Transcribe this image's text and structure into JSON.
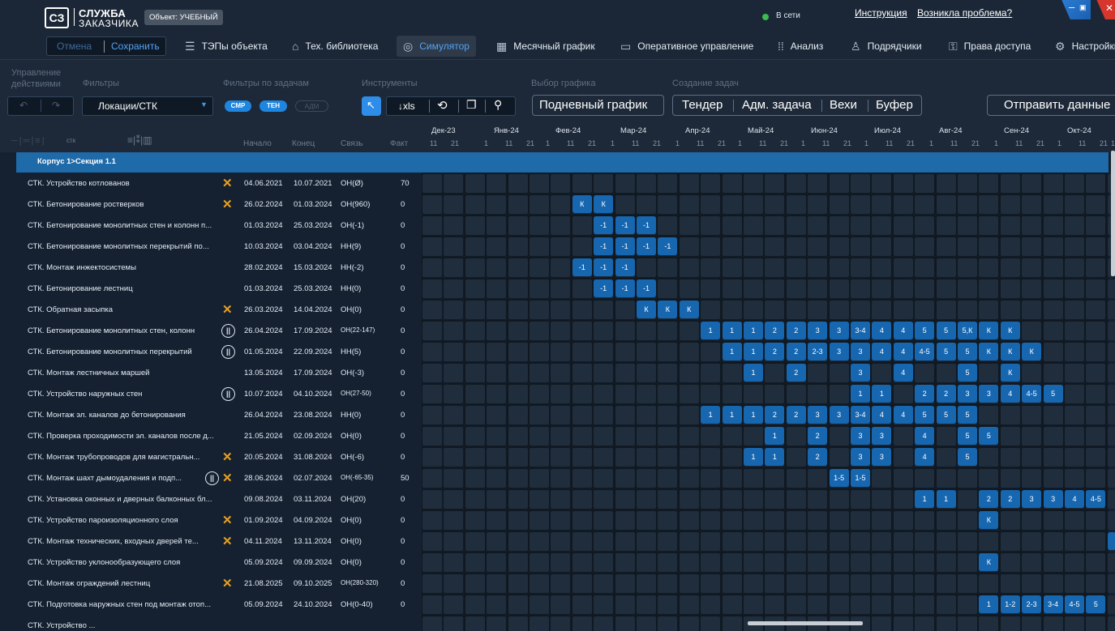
{
  "app": {
    "logo": "СЗ",
    "brand_line1": "СЛУЖБА",
    "brand_line2": "ЗАКАЗЧИКА",
    "object_badge": "Объект: УЧЕБНЫЙ",
    "status": "В сети",
    "link_instructions": "Инструкция",
    "link_problem": "Возникла проблема?"
  },
  "nav": {
    "cancel": "Отмена",
    "save": "Сохранить",
    "items": [
      "ТЭПы объекта",
      "Тех. библиотека",
      "Симулятор",
      "Месячный график",
      "Оперативное управление",
      "Анализ",
      "Подрядчики",
      "Права доступа",
      "Настройки"
    ]
  },
  "toolbar": {
    "label_actions": "Управление действиями",
    "label_filters": "Фильтры",
    "filter_value": "Локации/СТК",
    "label_task_filters": "Фильтры по задачам",
    "pills": [
      "СМР",
      "ТЕН",
      "АДМ"
    ],
    "label_tools": "Инструменты",
    "export_label": "↓xls",
    "label_schedule": "Выбор графика",
    "schedule_btn": "Подневный график",
    "label_create": "Создание задач",
    "create_items": [
      "Тендер",
      "Адм. задача",
      "Вехи",
      "Буфер"
    ],
    "send_btn": "Отправить данные"
  },
  "header": {
    "stk": "стк",
    "col_start": "Начало",
    "col_end": "Конец",
    "col_link": "Связь",
    "col_fact": "Факт",
    "months": [
      "Дек-23",
      "Янв-24",
      "Фев-24",
      "Мар-24",
      "Апр-24",
      "Май-24",
      "Июн-24",
      "Июл-24",
      "Авг-24",
      "Сен-24",
      "Окт-24"
    ],
    "month_days": [
      [
        "11",
        "21"
      ],
      [
        "1",
        "11",
        "21"
      ],
      [
        "1",
        "11",
        "21"
      ],
      [
        "1",
        "11",
        "21"
      ],
      [
        "1",
        "11",
        "21"
      ],
      [
        "1",
        "11",
        "21"
      ],
      [
        "1",
        "11",
        "21"
      ],
      [
        "1",
        "11",
        "21"
      ],
      [
        "1",
        "11",
        "21"
      ],
      [
        "1",
        "11",
        "21"
      ],
      [
        "1",
        "11",
        "21"
      ]
    ],
    "trailing_day": "1"
  },
  "group": "Корпус 1>Секция 1.1",
  "tasks": [
    {
      "name": "СТК. Устройство котлованов",
      "start": "04.06.2021",
      "end": "10.07.2021",
      "link": "ОН(Ø)",
      "fact": "70",
      "icons": [
        "x"
      ],
      "cells": []
    },
    {
      "name": "СТК. Бетонирование ростверков",
      "start": "26.02.2024",
      "end": "01.03.2024",
      "link": "ОН(960)",
      "fact": "0",
      "icons": [
        "x"
      ],
      "cells": [
        [
          7,
          "К"
        ],
        [
          8,
          "К"
        ]
      ]
    },
    {
      "name": "СТК. Бетонирование монолитных стен и колонн п...",
      "start": "01.03.2024",
      "end": "25.03.2024",
      "link": "ОН(-1)",
      "fact": "0",
      "icons": [],
      "cells": [
        [
          8,
          "-1"
        ],
        [
          9,
          "-1"
        ],
        [
          10,
          "-1"
        ]
      ]
    },
    {
      "name": "СТК. Бетонирование монолитных перекрытий по...",
      "start": "10.03.2024",
      "end": "03.04.2024",
      "link": "НН(9)",
      "fact": "0",
      "icons": [],
      "cells": [
        [
          8,
          "-1"
        ],
        [
          9,
          "-1"
        ],
        [
          10,
          "-1"
        ],
        [
          11,
          "-1"
        ]
      ]
    },
    {
      "name": "СТК. Монтаж инжектосистемы",
      "start": "28.02.2024",
      "end": "15.03.2024",
      "link": "НН(-2)",
      "fact": "0",
      "icons": [],
      "cells": [
        [
          7,
          "-1"
        ],
        [
          8,
          "-1"
        ],
        [
          9,
          "-1"
        ]
      ]
    },
    {
      "name": "СТК. Бетонирование лестниц",
      "start": "01.03.2024",
      "end": "25.03.2024",
      "link": "НН(0)",
      "fact": "0",
      "icons": [],
      "cells": [
        [
          8,
          "-1"
        ],
        [
          9,
          "-1"
        ],
        [
          10,
          "-1"
        ]
      ]
    },
    {
      "name": "СТК. Обратная засыпка",
      "start": "26.03.2024",
      "end": "14.04.2024",
      "link": "ОН(0)",
      "fact": "0",
      "icons": [
        "x"
      ],
      "cells": [
        [
          10,
          "К"
        ],
        [
          11,
          "К"
        ],
        [
          12,
          "К"
        ]
      ]
    },
    {
      "name": "СТК. Бетонирование монолитных стен, колонн",
      "start": "26.04.2024",
      "end": "17.09.2024",
      "link": "ОН(22-147)",
      "fact": "0",
      "icons": [
        "p"
      ],
      "cells": [
        [
          13,
          "1"
        ],
        [
          14,
          "1"
        ],
        [
          15,
          "1"
        ],
        [
          16,
          "2"
        ],
        [
          17,
          "2"
        ],
        [
          18,
          "3"
        ],
        [
          19,
          "3"
        ],
        [
          20,
          "3-4"
        ],
        [
          21,
          "4"
        ],
        [
          22,
          "4"
        ],
        [
          23,
          "5"
        ],
        [
          24,
          "5"
        ],
        [
          25,
          "5,К"
        ],
        [
          26,
          "К"
        ],
        [
          27,
          "К"
        ]
      ]
    },
    {
      "name": "СТК. Бетонирование монолитных перекрытий",
      "start": "01.05.2024",
      "end": "22.09.2024",
      "link": "НН(5)",
      "fact": "0",
      "icons": [
        "p"
      ],
      "cells": [
        [
          14,
          "1"
        ],
        [
          15,
          "1"
        ],
        [
          16,
          "2"
        ],
        [
          17,
          "2"
        ],
        [
          18,
          "2-3"
        ],
        [
          19,
          "3"
        ],
        [
          20,
          "3"
        ],
        [
          21,
          "4"
        ],
        [
          22,
          "4"
        ],
        [
          23,
          "4-5"
        ],
        [
          24,
          "5"
        ],
        [
          25,
          "5"
        ],
        [
          26,
          "К"
        ],
        [
          27,
          "К"
        ],
        [
          28,
          "К"
        ]
      ]
    },
    {
      "name": "СТК. Монтаж лестничных маршей",
      "start": "13.05.2024",
      "end": "17.09.2024",
      "link": "ОН(-3)",
      "fact": "0",
      "icons": [],
      "cells": [
        [
          15,
          "1"
        ],
        [
          17,
          "2"
        ],
        [
          20,
          "3"
        ],
        [
          22,
          "4"
        ],
        [
          25,
          "5"
        ],
        [
          27,
          "К"
        ]
      ]
    },
    {
      "name": "СТК. Устройство наружных стен",
      "start": "10.07.2024",
      "end": "04.10.2024",
      "link": "ОН(27-50)",
      "fact": "0",
      "icons": [
        "p"
      ],
      "cells": [
        [
          20,
          "1"
        ],
        [
          21,
          "1"
        ],
        [
          23,
          "2"
        ],
        [
          24,
          "2"
        ],
        [
          25,
          "3"
        ],
        [
          26,
          "3"
        ],
        [
          27,
          "4"
        ],
        [
          28,
          "4-5"
        ],
        [
          29,
          "5"
        ]
      ]
    },
    {
      "name": "СТК. Монтаж эл. каналов до бетонирования",
      "start": "26.04.2024",
      "end": "23.08.2024",
      "link": "НН(0)",
      "fact": "0",
      "icons": [],
      "cells": [
        [
          13,
          "1"
        ],
        [
          14,
          "1"
        ],
        [
          15,
          "1"
        ],
        [
          16,
          "2"
        ],
        [
          17,
          "2"
        ],
        [
          18,
          "3"
        ],
        [
          19,
          "3"
        ],
        [
          20,
          "3-4"
        ],
        [
          21,
          "4"
        ],
        [
          22,
          "4"
        ],
        [
          23,
          "5"
        ],
        [
          24,
          "5"
        ],
        [
          25,
          "5"
        ]
      ]
    },
    {
      "name": "СТК. Проверка проходимости эл. каналов после д...",
      "start": "21.05.2024",
      "end": "02.09.2024",
      "link": "ОН(0)",
      "fact": "0",
      "icons": [],
      "cells": [
        [
          16,
          "1"
        ],
        [
          18,
          "2"
        ],
        [
          20,
          "3"
        ],
        [
          21,
          "3"
        ],
        [
          23,
          "4"
        ],
        [
          25,
          "5"
        ],
        [
          26,
          "5"
        ]
      ]
    },
    {
      "name": "СТК. Монтаж трубопроводов для магистральн...",
      "start": "20.05.2024",
      "end": "31.08.2024",
      "link": "ОН(-6)",
      "fact": "0",
      "icons": [
        "x"
      ],
      "cells": [
        [
          15,
          "1"
        ],
        [
          16,
          "1"
        ],
        [
          18,
          "2"
        ],
        [
          20,
          "3"
        ],
        [
          21,
          "3"
        ],
        [
          23,
          "4"
        ],
        [
          25,
          "5"
        ]
      ]
    },
    {
      "name": "СТК. Монтаж шахт дымоудаления и подп...",
      "start": "28.06.2024",
      "end": "02.07.2024",
      "link": "ОН(-65-35)",
      "fact": "50",
      "icons": [
        "p",
        "x"
      ],
      "cells": [
        [
          19,
          "1-5"
        ],
        [
          20,
          "1-5"
        ]
      ]
    },
    {
      "name": "СТК. Установка оконных и дверных балконных бл...",
      "start": "09.08.2024",
      "end": "03.11.2024",
      "link": "ОН(20)",
      "fact": "0",
      "icons": [],
      "cells": [
        [
          23,
          "1"
        ],
        [
          24,
          "1"
        ],
        [
          26,
          "2"
        ],
        [
          27,
          "2"
        ],
        [
          28,
          "3"
        ],
        [
          29,
          "3"
        ],
        [
          30,
          "4"
        ],
        [
          31,
          "4-5"
        ]
      ]
    },
    {
      "name": "СТК. Устройство пароизоляционного слоя",
      "start": "01.09.2024",
      "end": "04.09.2024",
      "link": "ОН(0)",
      "fact": "0",
      "icons": [
        "x"
      ],
      "cells": [
        [
          26,
          "К"
        ]
      ]
    },
    {
      "name": "СТК. Монтаж технических, входных дверей те...",
      "start": "04.11.2024",
      "end": "13.11.2024",
      "link": "ОН(0)",
      "fact": "0",
      "icons": [
        "x"
      ],
      "cells": [
        [
          32,
          ""
        ]
      ]
    },
    {
      "name": "СТК. Устройство уклонообразующего слоя",
      "start": "05.09.2024",
      "end": "09.09.2024",
      "link": "ОН(0)",
      "fact": "0",
      "icons": [],
      "cells": [
        [
          26,
          "К"
        ]
      ]
    },
    {
      "name": "СТК. Монтаж ограждений лестниц",
      "start": "21.08.2025",
      "end": "09.10.2025",
      "link": "ОН(280-320)",
      "fact": "0",
      "icons": [
        "x"
      ],
      "cells": []
    },
    {
      "name": "СТК. Подготовка наружных стен под монтаж отоп...",
      "start": "05.09.2024",
      "end": "24.10.2024",
      "link": "ОН(0-40)",
      "fact": "0",
      "icons": [],
      "cells": [
        [
          26,
          "1"
        ],
        [
          27,
          "1-2"
        ],
        [
          28,
          "2-3"
        ],
        [
          29,
          "3-4"
        ],
        [
          30,
          "4-5"
        ],
        [
          31,
          "5"
        ]
      ]
    },
    {
      "name": "СТК. Устройство ...",
      "start": "",
      "end": "",
      "link": "",
      "fact": "",
      "icons": [],
      "cells": []
    }
  ]
}
